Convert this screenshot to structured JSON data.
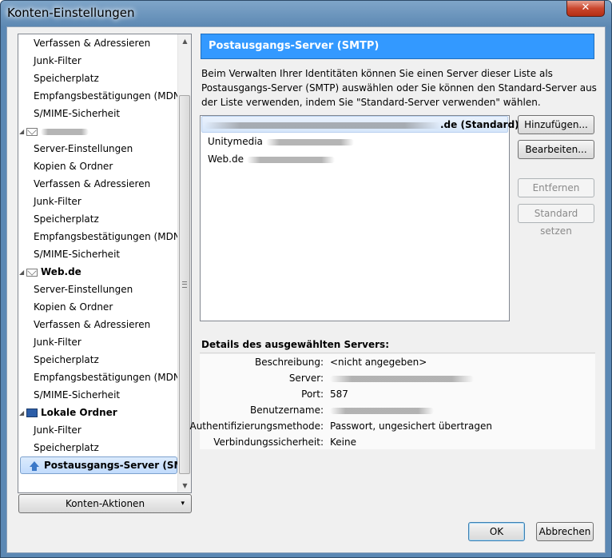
{
  "window": {
    "title": "Konten-Einstellungen",
    "close_glyph": "✕"
  },
  "tree": {
    "items": [
      {
        "label": "Verfassen & Adressieren",
        "kind": "child"
      },
      {
        "label": "Junk-Filter",
        "kind": "child"
      },
      {
        "label": "Speicherplatz",
        "kind": "child"
      },
      {
        "label": "Empfangsbestätigungen (MDN)",
        "kind": "child"
      },
      {
        "label": "S/MIME-Sicherheit",
        "kind": "child"
      },
      {
        "label": "",
        "kind": "account-blurred",
        "icon": "envelope-icon"
      },
      {
        "label": "Server-Einstellungen",
        "kind": "child"
      },
      {
        "label": "Kopien & Ordner",
        "kind": "child"
      },
      {
        "label": "Verfassen & Adressieren",
        "kind": "child"
      },
      {
        "label": "Junk-Filter",
        "kind": "child"
      },
      {
        "label": "Speicherplatz",
        "kind": "child"
      },
      {
        "label": "Empfangsbestätigungen (MDN)",
        "kind": "child"
      },
      {
        "label": "S/MIME-Sicherheit",
        "kind": "child"
      },
      {
        "label": "Web.de",
        "kind": "account",
        "icon": "envelope-icon"
      },
      {
        "label": "Server-Einstellungen",
        "kind": "child"
      },
      {
        "label": "Kopien & Ordner",
        "kind": "child"
      },
      {
        "label": "Verfassen & Adressieren",
        "kind": "child"
      },
      {
        "label": "Junk-Filter",
        "kind": "child"
      },
      {
        "label": "Speicherplatz",
        "kind": "child"
      },
      {
        "label": "Empfangsbestätigungen (MDN)",
        "kind": "child"
      },
      {
        "label": "S/MIME-Sicherheit",
        "kind": "child"
      },
      {
        "label": "Lokale Ordner",
        "kind": "account",
        "icon": "computer-icon"
      },
      {
        "label": "Junk-Filter",
        "kind": "child"
      },
      {
        "label": "Speicherplatz",
        "kind": "child"
      },
      {
        "label": "Postausgangs-Server (SMTP)",
        "kind": "selected",
        "icon": "outgoing-server-icon"
      }
    ]
  },
  "account_actions": {
    "label": "Konten-Aktionen",
    "arrow": "▾"
  },
  "panel": {
    "title": "Postausgangs-Server (SMTP)",
    "description": "Beim Verwalten Ihrer Identitäten können Sie einen Server dieser Liste als Postausgangs-Server (SMTP) auswählen oder Sie können den Standard-Server aus der Liste verwenden, indem Sie \"Standard-Server verwenden\" wählen.",
    "servers": [
      {
        "label": ".de (Standard)",
        "selected": true
      },
      {
        "label": "Unitymedia",
        "selected": false
      },
      {
        "label": "Web.de",
        "selected": false
      }
    ],
    "buttons": {
      "add": "Hinzufügen...",
      "edit": "Bearbeiten...",
      "remove": "Entfernen",
      "set_default": "Standard setzen"
    },
    "details_title": "Details des ausgewählten Servers:",
    "details": [
      {
        "label": "Beschreibung:",
        "value": "<nicht angegeben>"
      },
      {
        "label": "Server:",
        "value": ""
      },
      {
        "label": "Port:",
        "value": "587"
      },
      {
        "label": "Benutzername:",
        "value": ""
      },
      {
        "label": "Authentifizierungsmethode:",
        "value": "Passwort, ungesichert übertragen"
      },
      {
        "label": "Verbindungssicherheit:",
        "value": "Keine"
      }
    ]
  },
  "footer": {
    "ok": "OK",
    "cancel": "Abbrechen"
  }
}
